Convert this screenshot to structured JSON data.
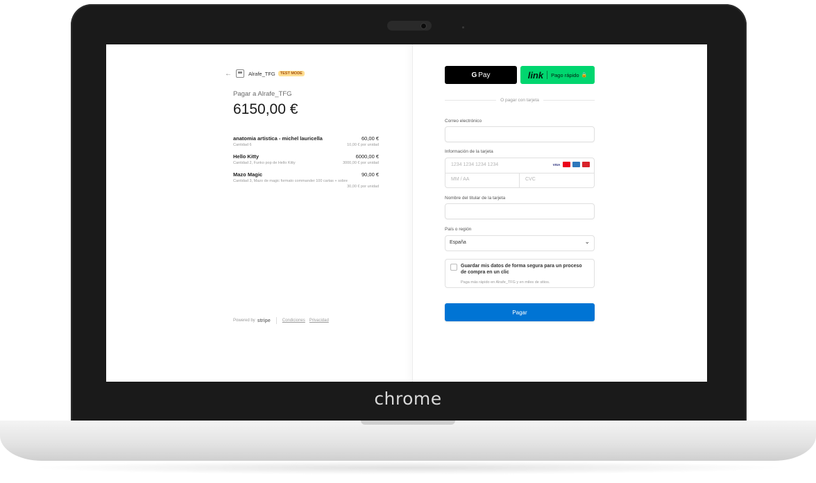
{
  "device": {
    "brand_label": "chrome"
  },
  "header": {
    "back_icon": "arrow-left-icon",
    "merchant_name": "Alrafe_TFG",
    "test_badge": "TEST MODE"
  },
  "summary": {
    "pay_to": "Pagar a Alrafe_TFG",
    "amount": "6150,00 €"
  },
  "items": [
    {
      "name": "anatomia artistica - michel lauricella",
      "price": "60,00 €",
      "detail": "Cantidad 6",
      "unit_price": "10,00 € por unidad"
    },
    {
      "name": "Hello Kitty",
      "price": "6000,00 €",
      "detail": "Cantidad 2, Funko pop de Hello Kitty",
      "unit_price": "3000,00 € por unidad"
    },
    {
      "name": "Mazo Magic",
      "price": "90,00 €",
      "detail": "Cantidad 3, Mazo de magic formato commander 100 cartas + sobre",
      "unit_price": "30,00 € por unidad"
    }
  ],
  "footer": {
    "powered_by": "Powered by",
    "stripe": "stripe",
    "terms": "Condiciones",
    "privacy": "Privacidad"
  },
  "payment": {
    "gpay_g": "G",
    "gpay_label": "Pay",
    "link_logo": "link",
    "link_label": "Pago rápido",
    "or_text": "O pagar con tarjeta",
    "email_label": "Correo electrónico",
    "email_value": "",
    "card_label": "Información de la tarjeta",
    "card_number_placeholder": "1234 1234 1234 1234",
    "card_brands": [
      "VISA",
      "mastercard",
      "amex",
      "unionpay"
    ],
    "expiry_placeholder": "MM / AA",
    "cvc_placeholder": "CVC",
    "name_label": "Nombre del titular de la tarjeta",
    "name_value": "",
    "country_label": "País o región",
    "country_value": "España",
    "save_title": "Guardar mis datos de forma segura para un proceso de compra en un clic",
    "save_subtitle": "Paga más rápido en Alrafe_TFG y en miles de sitios.",
    "pay_button": "Pagar"
  },
  "colors": {
    "pay_button": "#0074d4",
    "link_button": "#00d66f",
    "test_badge_bg": "#ffde92"
  }
}
